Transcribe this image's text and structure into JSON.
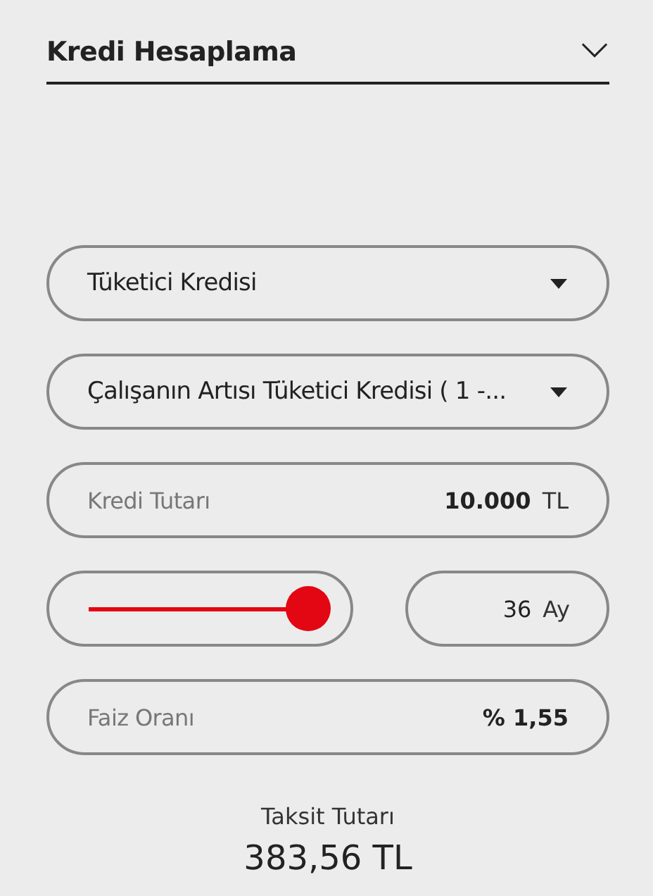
{
  "header": {
    "title": "Kredi Hesaplama",
    "expanded": true
  },
  "dropdowns": [
    {
      "value": "Tüketici Kredisi"
    },
    {
      "value": "Çalışanın Artısı Tüketici Kredisi ( 1 -..."
    }
  ],
  "amount": {
    "label": "Kredi Tutarı",
    "value": "10.000",
    "unit": "TL"
  },
  "term": {
    "level": 1,
    "value": "36",
    "unit": "Ay"
  },
  "rate": {
    "label": "Faiz Oranı",
    "value": "% 1,55"
  },
  "result": {
    "label": "Taksit Tutarı",
    "value": "383,56 TL"
  }
}
